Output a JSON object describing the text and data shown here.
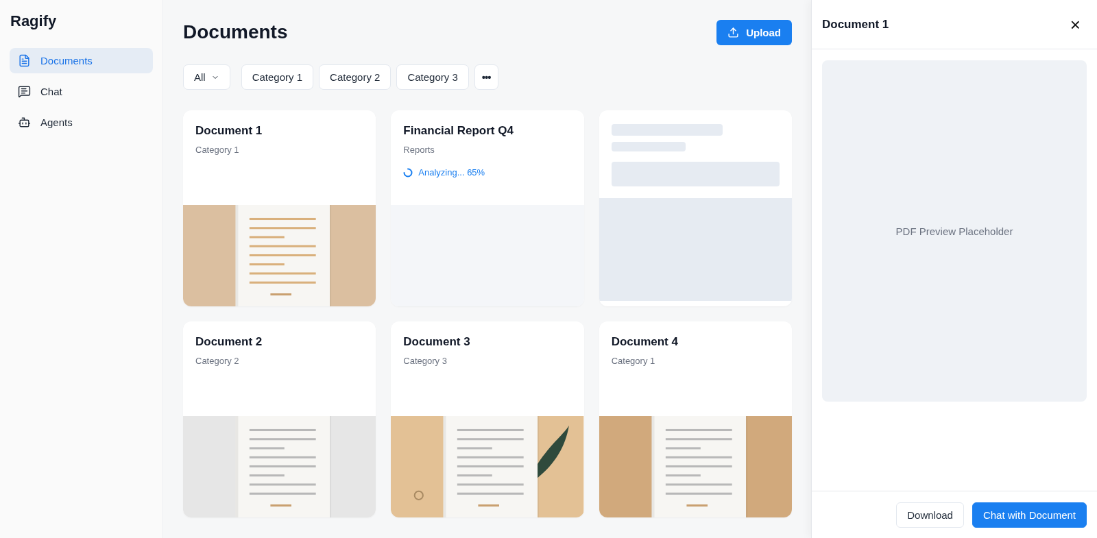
{
  "app": {
    "name": "Ragify"
  },
  "sidebar": {
    "items": [
      {
        "label": "Documents",
        "selected": true
      },
      {
        "label": "Chat",
        "selected": false
      },
      {
        "label": "Agents",
        "selected": false
      }
    ]
  },
  "main": {
    "title": "Documents",
    "upload_button": "Upload",
    "filters": [
      {
        "label": "All",
        "kind": "dropdown"
      },
      {
        "label": "Category 1",
        "kind": "chip"
      },
      {
        "label": "Category 2",
        "kind": "chip"
      },
      {
        "label": "Category 3",
        "kind": "chip"
      },
      {
        "label": "•••",
        "kind": "more"
      }
    ],
    "cards": [
      {
        "kind": "document",
        "title": "Document 1",
        "category": "Category 1"
      },
      {
        "kind": "analyzing",
        "title": "Financial Report Q4",
        "category": "Reports",
        "status": "Analyzing... 65%"
      },
      {
        "kind": "loading"
      },
      {
        "kind": "document",
        "title": "Document 2",
        "category": "Category 2"
      },
      {
        "kind": "document",
        "title": "Document 3",
        "category": "Category 3"
      },
      {
        "kind": "document",
        "title": "Document 4",
        "category": "Category 1"
      }
    ]
  },
  "panel": {
    "title": "Document 1",
    "close": "×",
    "preview_text": "PDF Preview Placeholder",
    "buttons": [
      {
        "label": "Download",
        "kind": "secondary"
      },
      {
        "label": "Chat with Document",
        "kind": "primary"
      }
    ]
  }
}
